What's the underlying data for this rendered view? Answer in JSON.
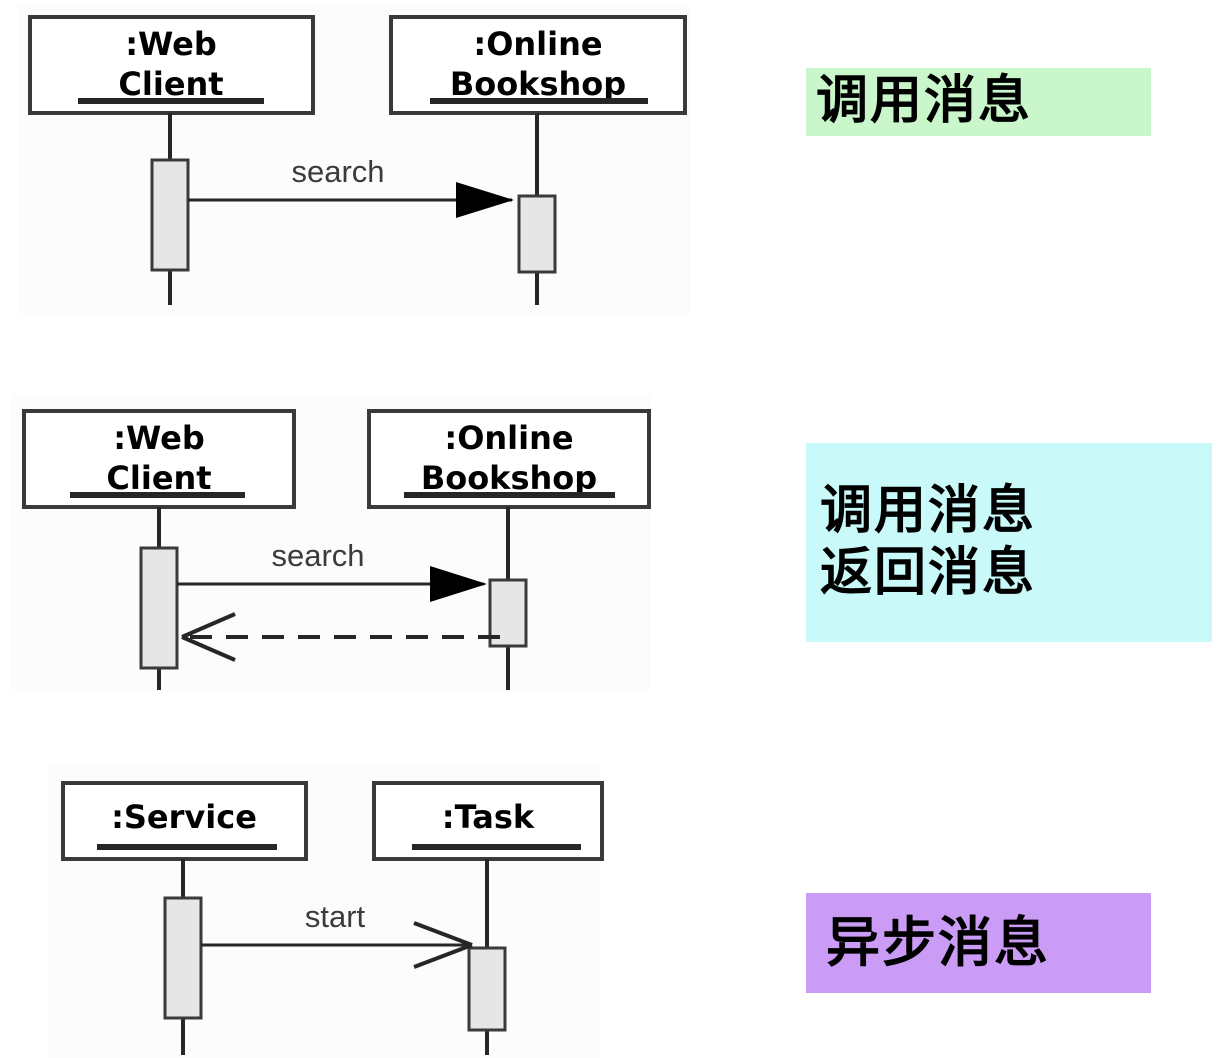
{
  "diagrams": [
    {
      "id": "call-message",
      "participants": [
        {
          "prefix": ":Web",
          "suffix": "Client"
        },
        {
          "prefix": ":Online",
          "suffix": "Bookshop"
        }
      ],
      "messages": [
        {
          "label": "search",
          "kind": "call",
          "direction": "right",
          "line": "solid",
          "arrowhead": "filled-triangle"
        }
      ]
    },
    {
      "id": "call-and-return-message",
      "participants": [
        {
          "prefix": ":Web",
          "suffix": "Client"
        },
        {
          "prefix": ":Online",
          "suffix": "Bookshop"
        }
      ],
      "messages": [
        {
          "label": "search",
          "kind": "call",
          "direction": "right",
          "line": "solid",
          "arrowhead": "filled-triangle"
        },
        {
          "label": "",
          "kind": "return",
          "direction": "left",
          "line": "dashed",
          "arrowhead": "open-v"
        }
      ]
    },
    {
      "id": "async-message",
      "participants": [
        {
          "prefix": ":Service",
          "suffix": ""
        },
        {
          "prefix": ":Task",
          "suffix": ""
        }
      ],
      "messages": [
        {
          "label": "start",
          "kind": "async",
          "direction": "right",
          "line": "solid",
          "arrowhead": "open-v"
        }
      ]
    }
  ],
  "annotations": [
    {
      "id": "annotation-call-message",
      "lines": [
        "调用消息"
      ],
      "background": "#c9f7cb"
    },
    {
      "id": "annotation-call-return-message",
      "lines": [
        "调用消息",
        "返回消息"
      ],
      "background": "#c9f9f9"
    },
    {
      "id": "annotation-async-message",
      "lines": [
        "异步消息"
      ],
      "background": "#ca9cf5"
    }
  ],
  "colors": {
    "lifeline_box_fill": "#ffffff",
    "activation_fill": "#e6e6e6",
    "stroke": "#3a3a3a",
    "diagram_backdrop": "#fcfcfc",
    "page_background": "#ffffff"
  }
}
